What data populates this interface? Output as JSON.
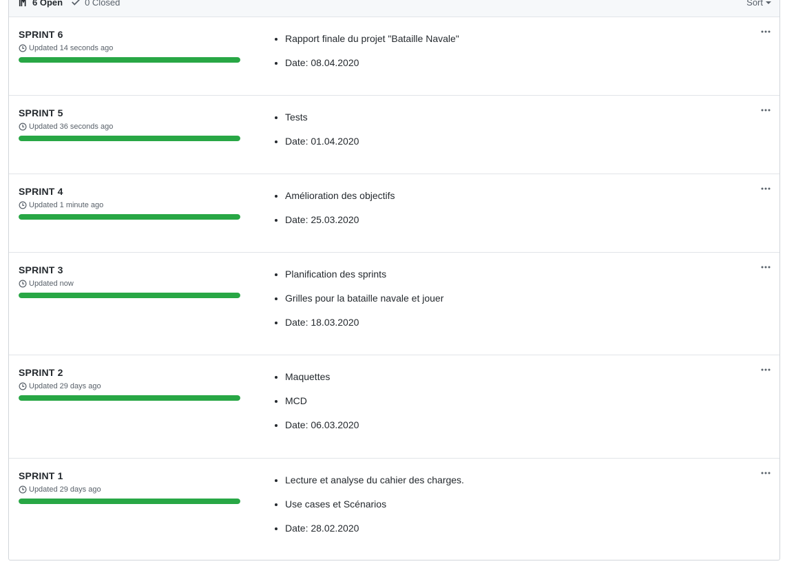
{
  "header": {
    "open_label": "6 Open",
    "closed_label": "0 Closed",
    "sort_label": "Sort",
    "colors": {
      "header_bg": "#f6f8fa",
      "border": "#e1e4e8"
    }
  },
  "milestones": [
    {
      "title": "SPRINT 6",
      "updated": "Updated 14 seconds ago",
      "progress": 1.0,
      "items": [
        "Rapport finale du projet \"Bataille Navale\"",
        "Date: 08.04.2020"
      ]
    },
    {
      "title": "SPRINT 5",
      "updated": "Updated 36 seconds ago",
      "progress": 1.0,
      "items": [
        "Tests",
        "Date: 01.04.2020"
      ]
    },
    {
      "title": "SPRINT 4",
      "updated": "Updated 1 minute ago",
      "progress": 1.0,
      "items": [
        "Amélioration des objectifs",
        "Date: 25.03.2020"
      ]
    },
    {
      "title": "SPRINT 3",
      "updated": "Updated now",
      "progress": 1.0,
      "items": [
        "Planification des sprints",
        "Grilles pour la bataille navale et jouer",
        "Date: 18.03.2020"
      ]
    },
    {
      "title": "SPRINT 2",
      "updated": "Updated 29 days ago",
      "progress": 1.0,
      "items": [
        "Maquettes",
        "MCD",
        "Date: 06.03.2020"
      ]
    },
    {
      "title": "SPRINT 1",
      "updated": "Updated 29 days ago",
      "progress": 1.0,
      "items": [
        "Lecture et analyse du cahier des charges.",
        "Use cases et Scénarios",
        "Date: 28.02.2020"
      ]
    }
  ],
  "icons": {
    "open": "milestone-icon",
    "closed": "check-icon",
    "updated": "clock-icon",
    "more": "kebab-horizontal-icon"
  },
  "colors": {
    "progress_fill": "#28a745",
    "progress_track": "#e1e4e8",
    "muted_text": "#586069"
  }
}
